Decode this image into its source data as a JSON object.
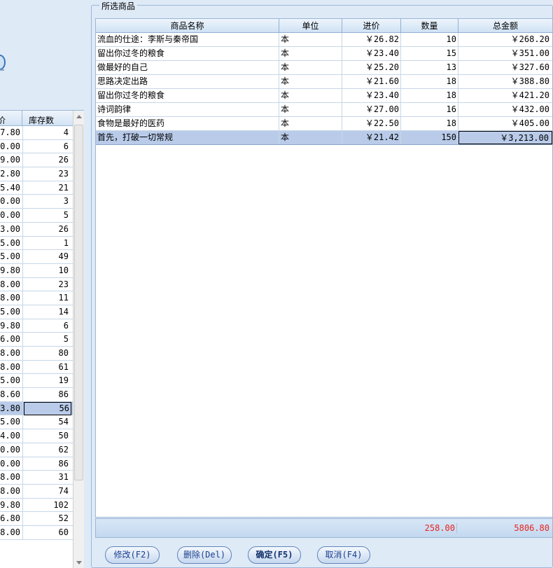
{
  "stock_list": {
    "headers": [
      "价",
      "库存数"
    ],
    "rows": [
      [
        "7.80",
        "4"
      ],
      [
        "0.00",
        "6"
      ],
      [
        "9.00",
        "26"
      ],
      [
        "2.80",
        "23"
      ],
      [
        "5.40",
        "21"
      ],
      [
        "0.00",
        "3"
      ],
      [
        "0.00",
        "5"
      ],
      [
        "3.00",
        "26"
      ],
      [
        "5.00",
        "1"
      ],
      [
        "5.00",
        "49"
      ],
      [
        "9.80",
        "10"
      ],
      [
        "8.00",
        "23"
      ],
      [
        "8.00",
        "11"
      ],
      [
        "5.00",
        "14"
      ],
      [
        "9.80",
        "6"
      ],
      [
        "6.00",
        "5"
      ],
      [
        "8.00",
        "80"
      ],
      [
        "8.00",
        "61"
      ],
      [
        "5.00",
        "19"
      ],
      [
        "8.60",
        "86"
      ],
      [
        "3.80",
        "56"
      ],
      [
        "5.00",
        "54"
      ],
      [
        "4.00",
        "50"
      ],
      [
        "0.00",
        "62"
      ],
      [
        "0.00",
        "86"
      ],
      [
        "8.00",
        "31"
      ],
      [
        "8.00",
        "74"
      ],
      [
        "9.80",
        "102"
      ],
      [
        "6.80",
        "52"
      ],
      [
        "8.00",
        "60"
      ]
    ],
    "selected_index": 20
  },
  "selected_goods": {
    "title": "所选商品",
    "headers": {
      "name": "商品名称",
      "unit": "单位",
      "price": "进价",
      "qty": "数量",
      "total": "总金额"
    },
    "rows": [
      {
        "name": "流血的仕途：李斯与秦帝国",
        "unit": "本",
        "price": "￥26.82",
        "qty": "10",
        "total": "￥268.20"
      },
      {
        "name": "留出你过冬的粮食",
        "unit": "本",
        "price": "￥23.40",
        "qty": "15",
        "total": "￥351.00"
      },
      {
        "name": "做最好的自己",
        "unit": "本",
        "price": "￥25.20",
        "qty": "13",
        "total": "￥327.60"
      },
      {
        "name": "思路决定出路",
        "unit": "本",
        "price": "￥21.60",
        "qty": "18",
        "total": "￥388.80"
      },
      {
        "name": "留出你过冬的粮食",
        "unit": "本",
        "price": "￥23.40",
        "qty": "18",
        "total": "￥421.20"
      },
      {
        "name": "诗词韵律",
        "unit": "本",
        "price": "￥27.00",
        "qty": "16",
        "total": "￥432.00"
      },
      {
        "name": "食物是最好的医药",
        "unit": "本",
        "price": "￥22.50",
        "qty": "18",
        "total": "￥405.00"
      },
      {
        "name": "首先，打破一切常规",
        "unit": "本",
        "price": "￥21.42",
        "qty": "150",
        "total": "￥3,213.00"
      }
    ],
    "selected_index": 7,
    "summary": {
      "qty_total": "258.00",
      "amount_total": "5806.80"
    }
  },
  "buttons": {
    "modify": "修改(F2)",
    "delete": "删除(Del)",
    "confirm": "确定(F5)",
    "cancel": "取消(F4)"
  }
}
